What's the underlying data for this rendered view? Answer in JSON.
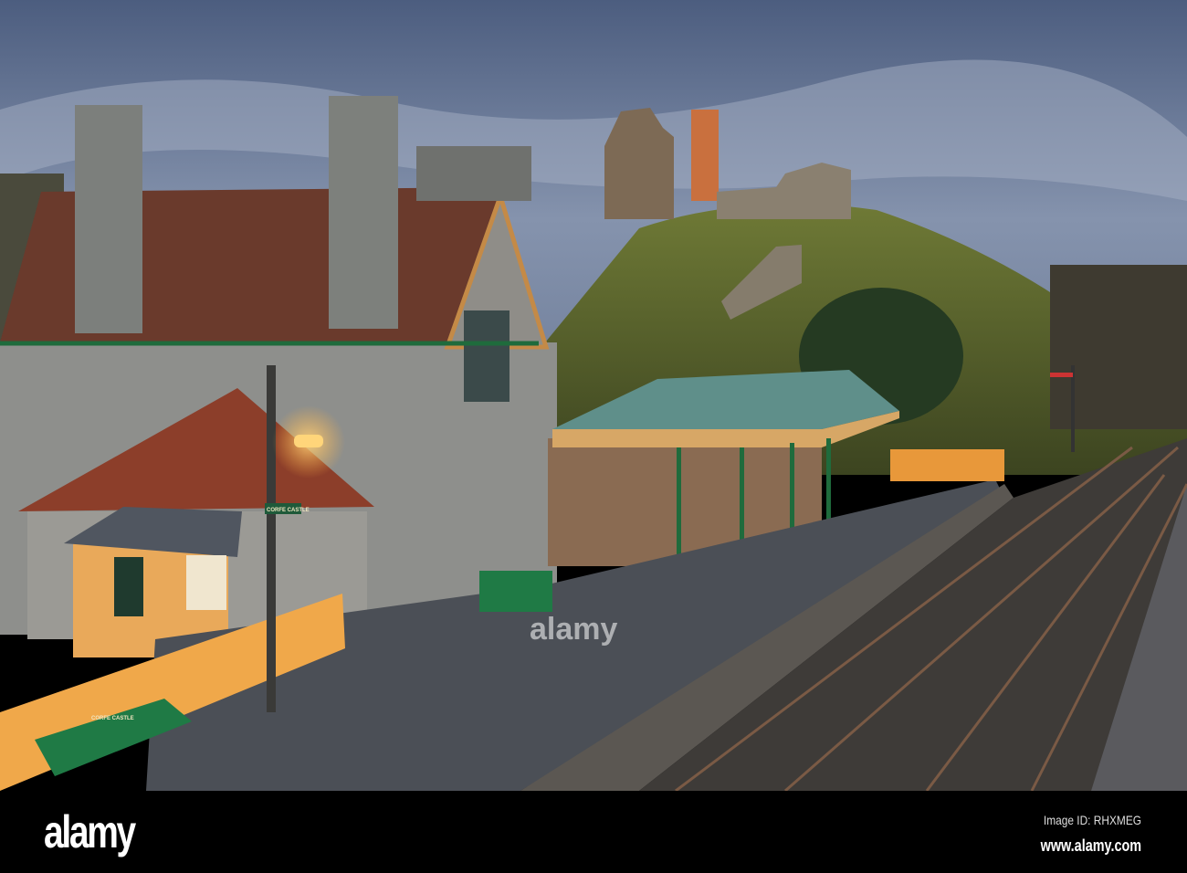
{
  "photo": {
    "subject": "Corfe Castle railway station",
    "lamp_sign": "CORFE CASTLE",
    "bench_sign": "CORFE CASTLE",
    "watermark": "alamy"
  },
  "footer": {
    "logo": "alamy",
    "image_id": "Image ID: RHXMEG",
    "website": "www.alamy.com"
  },
  "colors": {
    "sky": "#5b6f8e",
    "roof": "#6a3a2c",
    "stone": "#8e8f8c",
    "green_trim": "#1f6b3c",
    "fence": "#f0a84a",
    "canopy": "#5f8f8a",
    "hill": "#5e6b2d"
  }
}
